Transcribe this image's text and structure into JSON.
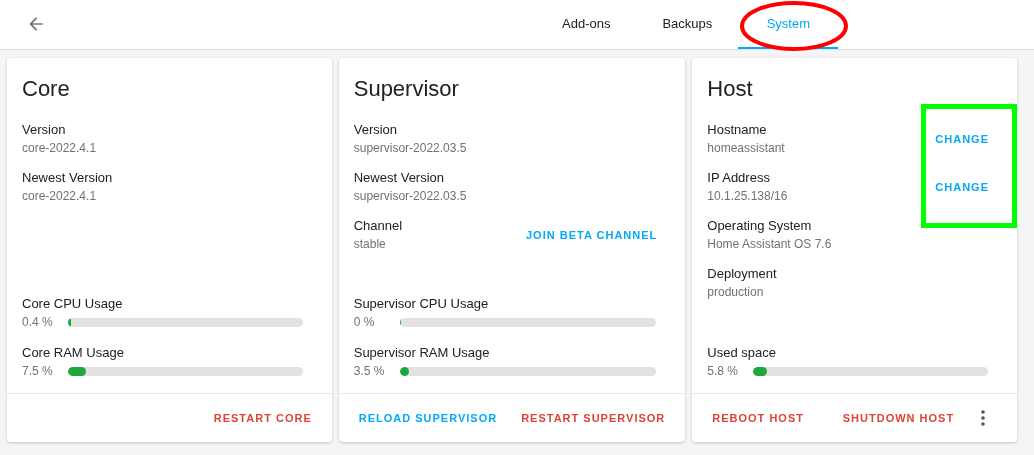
{
  "tabs": [
    {
      "label": "Add-ons",
      "selected": false
    },
    {
      "label": "Backups",
      "selected": false
    },
    {
      "label": "System",
      "selected": true
    }
  ],
  "cards": [
    {
      "title": "Core",
      "info": [
        {
          "label": "Version",
          "value": "core-2022.4.1"
        },
        {
          "label": "Newest Version",
          "value": "core-2022.4.1"
        }
      ],
      "metrics": [
        {
          "label": "Core CPU Usage",
          "reading": "0.4 %",
          "level": 0.004
        },
        {
          "label": "Core RAM Usage",
          "reading": "7.5 %",
          "level": 0.075
        }
      ],
      "actions": [
        {
          "label": "RESTART CORE",
          "kind": "danger"
        }
      ],
      "menu": false
    },
    {
      "title": "Supervisor",
      "info": [
        {
          "label": "Version",
          "value": "supervisor-2022.03.5"
        },
        {
          "label": "Newest Version",
          "value": "supervisor-2022.03.5"
        },
        {
          "label": "Channel",
          "value": "stable",
          "action": "JOIN BETA CHANNEL"
        }
      ],
      "metrics": [
        {
          "label": "Supervisor CPU Usage",
          "reading": "0 %",
          "level": 0
        },
        {
          "label": "Supervisor RAM Usage",
          "reading": "3.5 %",
          "level": 0.035
        }
      ],
      "actions": [
        {
          "label": "RELOAD SUPERVISOR",
          "kind": "primary"
        },
        {
          "label": "RESTART SUPERVISOR",
          "kind": "danger"
        }
      ],
      "menu": false
    },
    {
      "title": "Host",
      "info": [
        {
          "label": "Hostname",
          "value": "homeassistant",
          "action": "CHANGE"
        },
        {
          "label": "IP Address",
          "value": "10.1.25.138/16",
          "action": "CHANGE"
        },
        {
          "label": "Operating System",
          "value": "Home Assistant OS 7.6"
        },
        {
          "label": "Deployment",
          "value": "production"
        }
      ],
      "metrics": [
        {
          "label": "Used space",
          "reading": "5.8 %",
          "level": 0.058
        }
      ],
      "actions": [
        {
          "label": "REBOOT HOST",
          "kind": "danger"
        },
        {
          "label": "SHUTDOWN HOST",
          "kind": "danger"
        }
      ],
      "menu": true
    }
  ]
}
